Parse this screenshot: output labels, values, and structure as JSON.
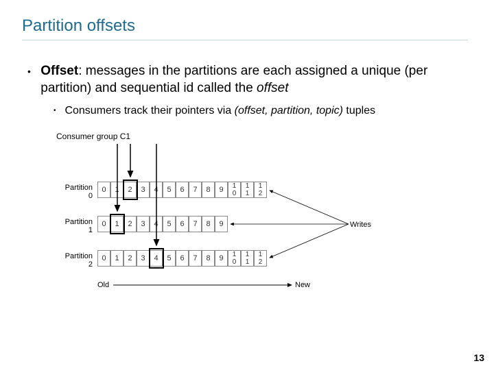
{
  "title": "Partition offsets",
  "bullets": {
    "main": {
      "bold": "Offset",
      "rest": ":  messages in the partitions are each assigned a unique (per partition) and sequential id called the ",
      "italic": "offset"
    },
    "sub": {
      "prefix": "Consumers track their pointers via ",
      "italic": "(offset, partition, topic)",
      "suffix": " tuples"
    }
  },
  "consumer_group": "Consumer group C1",
  "partitions": [
    {
      "label_top": "Partition",
      "label_bottom": "0",
      "cells": [
        "0",
        "1",
        "2",
        "3",
        "4",
        "5",
        "6",
        "7",
        "8",
        "9",
        "1",
        "1",
        "1"
      ],
      "sub": [
        "",
        "",
        "",
        "",
        "",
        "",
        "",
        "",
        "",
        "",
        "0",
        "1",
        "2"
      ],
      "highlight_index": 2,
      "count": 13
    },
    {
      "label_top": "Partition",
      "label_bottom": "1",
      "cells": [
        "0",
        "1",
        "2",
        "3",
        "4",
        "5",
        "6",
        "7",
        "8",
        "9"
      ],
      "sub": [],
      "highlight_index": 1,
      "count": 10
    },
    {
      "label_top": "Partition",
      "label_bottom": "2",
      "cells": [
        "0",
        "1",
        "2",
        "3",
        "4",
        "5",
        "6",
        "7",
        "8",
        "9",
        "1",
        "1",
        "1"
      ],
      "sub": [
        "",
        "",
        "",
        "",
        "",
        "",
        "",
        "",
        "",
        "",
        "0",
        "1",
        "2"
      ],
      "highlight_index": 4,
      "count": 13
    }
  ],
  "axis": {
    "old": "Old",
    "new": "New",
    "writes": "Writes"
  },
  "page": "13"
}
